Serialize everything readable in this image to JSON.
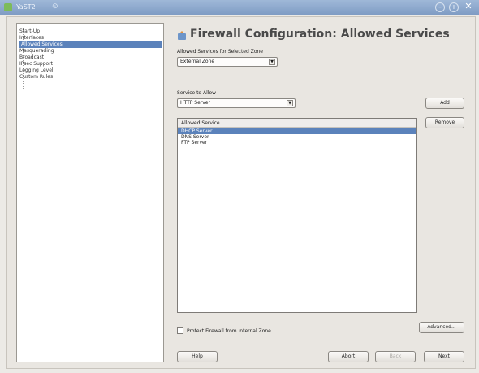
{
  "window": {
    "title": "YaST2",
    "icons": {
      "app": "yast-icon",
      "pin": "pin-icon",
      "minimize": "minimize-icon",
      "maximize": "maximize-icon",
      "close": "close-icon"
    }
  },
  "sidebar": {
    "items": [
      {
        "label": "Start-Up",
        "selected": false
      },
      {
        "label": "Interfaces",
        "selected": false
      },
      {
        "label": "Allowed Services",
        "selected": true
      },
      {
        "label": "Masquerading",
        "selected": false
      },
      {
        "label": "Broadcast",
        "selected": false
      },
      {
        "label": "IPsec Support",
        "selected": false
      },
      {
        "label": "Logging Level",
        "selected": false
      },
      {
        "label": "Custom Rules",
        "selected": false
      }
    ]
  },
  "main": {
    "title": "Firewall Configuration: Allowed Services",
    "zone_label": "Allowed Services for Selected Zone",
    "zone_value": "External Zone",
    "service_label": "Service to Allow",
    "service_value": "HTTP Server",
    "add_button": "Add",
    "remove_button": "Remove",
    "list_header": "Allowed Service",
    "allowed_services": [
      {
        "label": "DHCP Server",
        "selected": true
      },
      {
        "label": "DNS Server",
        "selected": false
      },
      {
        "label": "FTP Server",
        "selected": false
      }
    ],
    "protect_checkbox_label": "Protect Firewall from Internal Zone",
    "protect_checked": false,
    "advanced_button": "Advanced..."
  },
  "footer": {
    "help_button": "Help",
    "abort_button": "Abort",
    "back_button": "Back",
    "next_button": "Next"
  }
}
